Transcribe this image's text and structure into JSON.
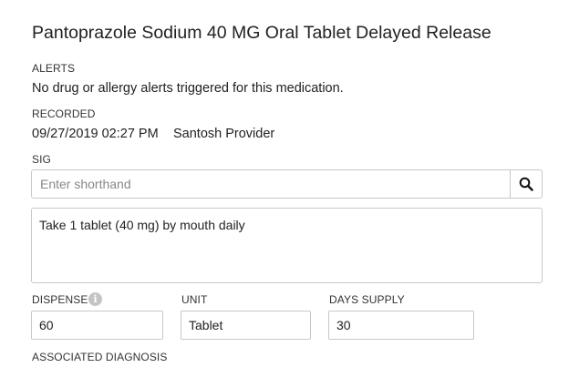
{
  "medication": {
    "title": "Pantoprazole Sodium 40 MG Oral Tablet Delayed Release"
  },
  "alerts": {
    "label": "ALERTS",
    "text": "No drug or allergy alerts triggered for this medication."
  },
  "recorded": {
    "label": "RECORDED",
    "datetime": "09/27/2019 02:27 PM",
    "provider": "Santosh Provider"
  },
  "sig": {
    "label": "SIG",
    "shorthand_placeholder": "Enter shorthand",
    "search_icon": "search-icon",
    "text": "Take 1 tablet (40 mg) by mouth daily"
  },
  "dispense": {
    "label": "DISPENSE",
    "value": "60",
    "info_icon": "info-icon"
  },
  "unit": {
    "label": "UNIT",
    "value": "Tablet"
  },
  "days_supply": {
    "label": "DAYS SUPPLY",
    "value": "30"
  },
  "diagnosis": {
    "label": "ASSOCIATED DIAGNOSIS"
  }
}
